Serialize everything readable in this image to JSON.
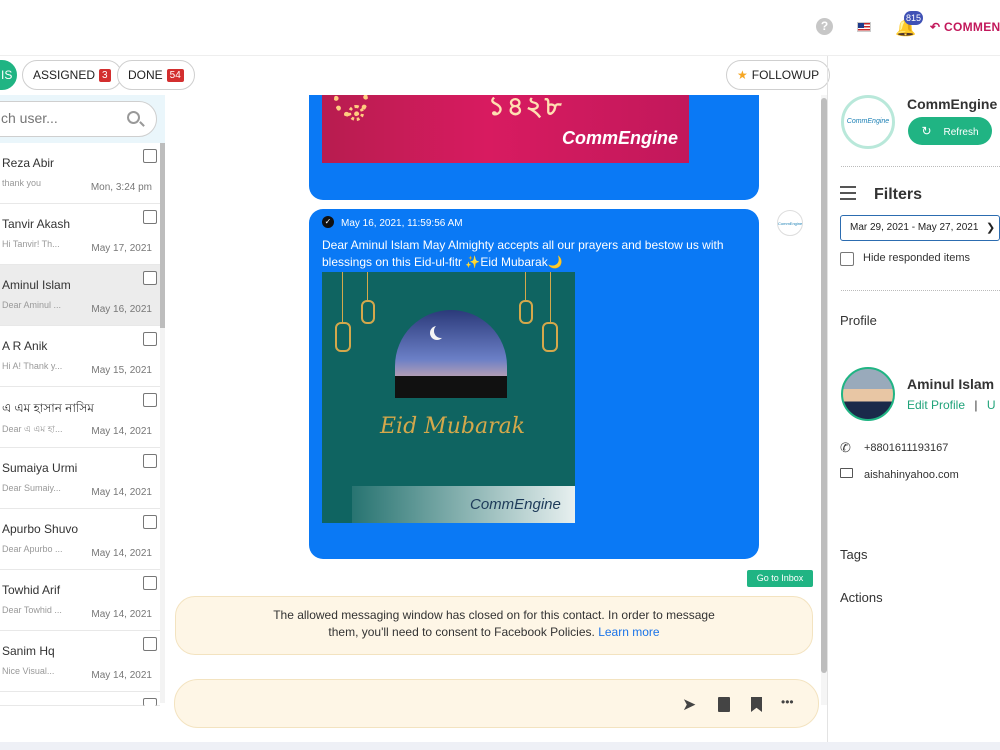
{
  "topbar": {
    "help_glyph": "?",
    "notification_count": "815",
    "comment_link": "COMMEN",
    "icons": [
      "help-icon",
      "us-flag-icon",
      "bell-icon",
      "reply-arrow-icon"
    ]
  },
  "tabs": {
    "active_fragment": "IS",
    "assigned_label": "ASSIGNED",
    "assigned_count": "3",
    "done_label": "DONE",
    "done_count": "54",
    "followup_label": "FOLLOWUP"
  },
  "search": {
    "placeholder": "ch user..."
  },
  "conversations": [
    {
      "name": "Reza Abir",
      "preview": "thank you",
      "date": "Mon, 3:24 pm"
    },
    {
      "name": "Tanvir Akash",
      "preview": "Hi Tanvir! Th...",
      "date": "May 17, 2021"
    },
    {
      "name": "Aminul Islam",
      "preview": "Dear Aminul ...",
      "date": "May 16, 2021",
      "selected": true
    },
    {
      "name": "A R Anik",
      "preview": "Hi A! Thank y...",
      "date": "May 15, 2021"
    },
    {
      "name": "এ এম হাসান নাসিম",
      "preview": "Dear এ এম হা...",
      "date": "May 14, 2021"
    },
    {
      "name": "Sumaiya Urmi",
      "preview": "Dear Sumaiy...",
      "date": "May 14, 2021"
    },
    {
      "name": "Apurbo Shuvo",
      "preview": "Dear Apurbo ...",
      "date": "May 14, 2021"
    },
    {
      "name": "Towhid Arif",
      "preview": "Dear Towhid ...",
      "date": "May 14, 2021"
    },
    {
      "name": "Sanim Hq",
      "preview": "Nice Visual...",
      "date": "May 14, 2021"
    }
  ],
  "chat": {
    "prev_image": {
      "number_text": "১৪২৮",
      "logo": "CommEngine"
    },
    "message": {
      "timestamp": "May 16, 2021, 11:59:56 AM",
      "text": "Dear Aminul Islam May Almighty accepts all our prayers and bestow us with blessings on this Eid-ul-fitr ✨Eid Mubarak🌙",
      "image_caption": "Eid Mubarak",
      "image_logo": "CommEngine"
    },
    "sender_avatar_text": "CommEngine",
    "go_to_inbox": "Go to Inbox",
    "notice": {
      "line1": "The allowed messaging window has closed on for this contact. In order to message",
      "line2": "them, you'll need to consent to Facebook Policies.",
      "link": "Learn more"
    },
    "composer_icons": [
      "send-icon",
      "file-icon",
      "bookmark-icon",
      "more-icon"
    ],
    "more_glyph": "•••"
  },
  "right": {
    "org_logo_text": "CommEngine",
    "org_name": "CommEngine",
    "refresh_label": "Refresh",
    "filters_title": "Filters",
    "date_range": "Mar 29, 2021 - May 27, 2021",
    "hide_responded": "Hide responded items",
    "profile_label": "Profile",
    "profile_name": "Aminul Islam",
    "edit_profile": "Edit Profile",
    "separator": "|",
    "link_fragment": "U",
    "phone": "+8801611193167",
    "email": "aishahinyahoo.com",
    "tags_label": "Tags",
    "actions_label": "Actions"
  },
  "colors": {
    "accent": "#20b483",
    "bubble": "#0a79f5",
    "badge": "#d32f2f",
    "notice_bg": "#fef6e6"
  }
}
